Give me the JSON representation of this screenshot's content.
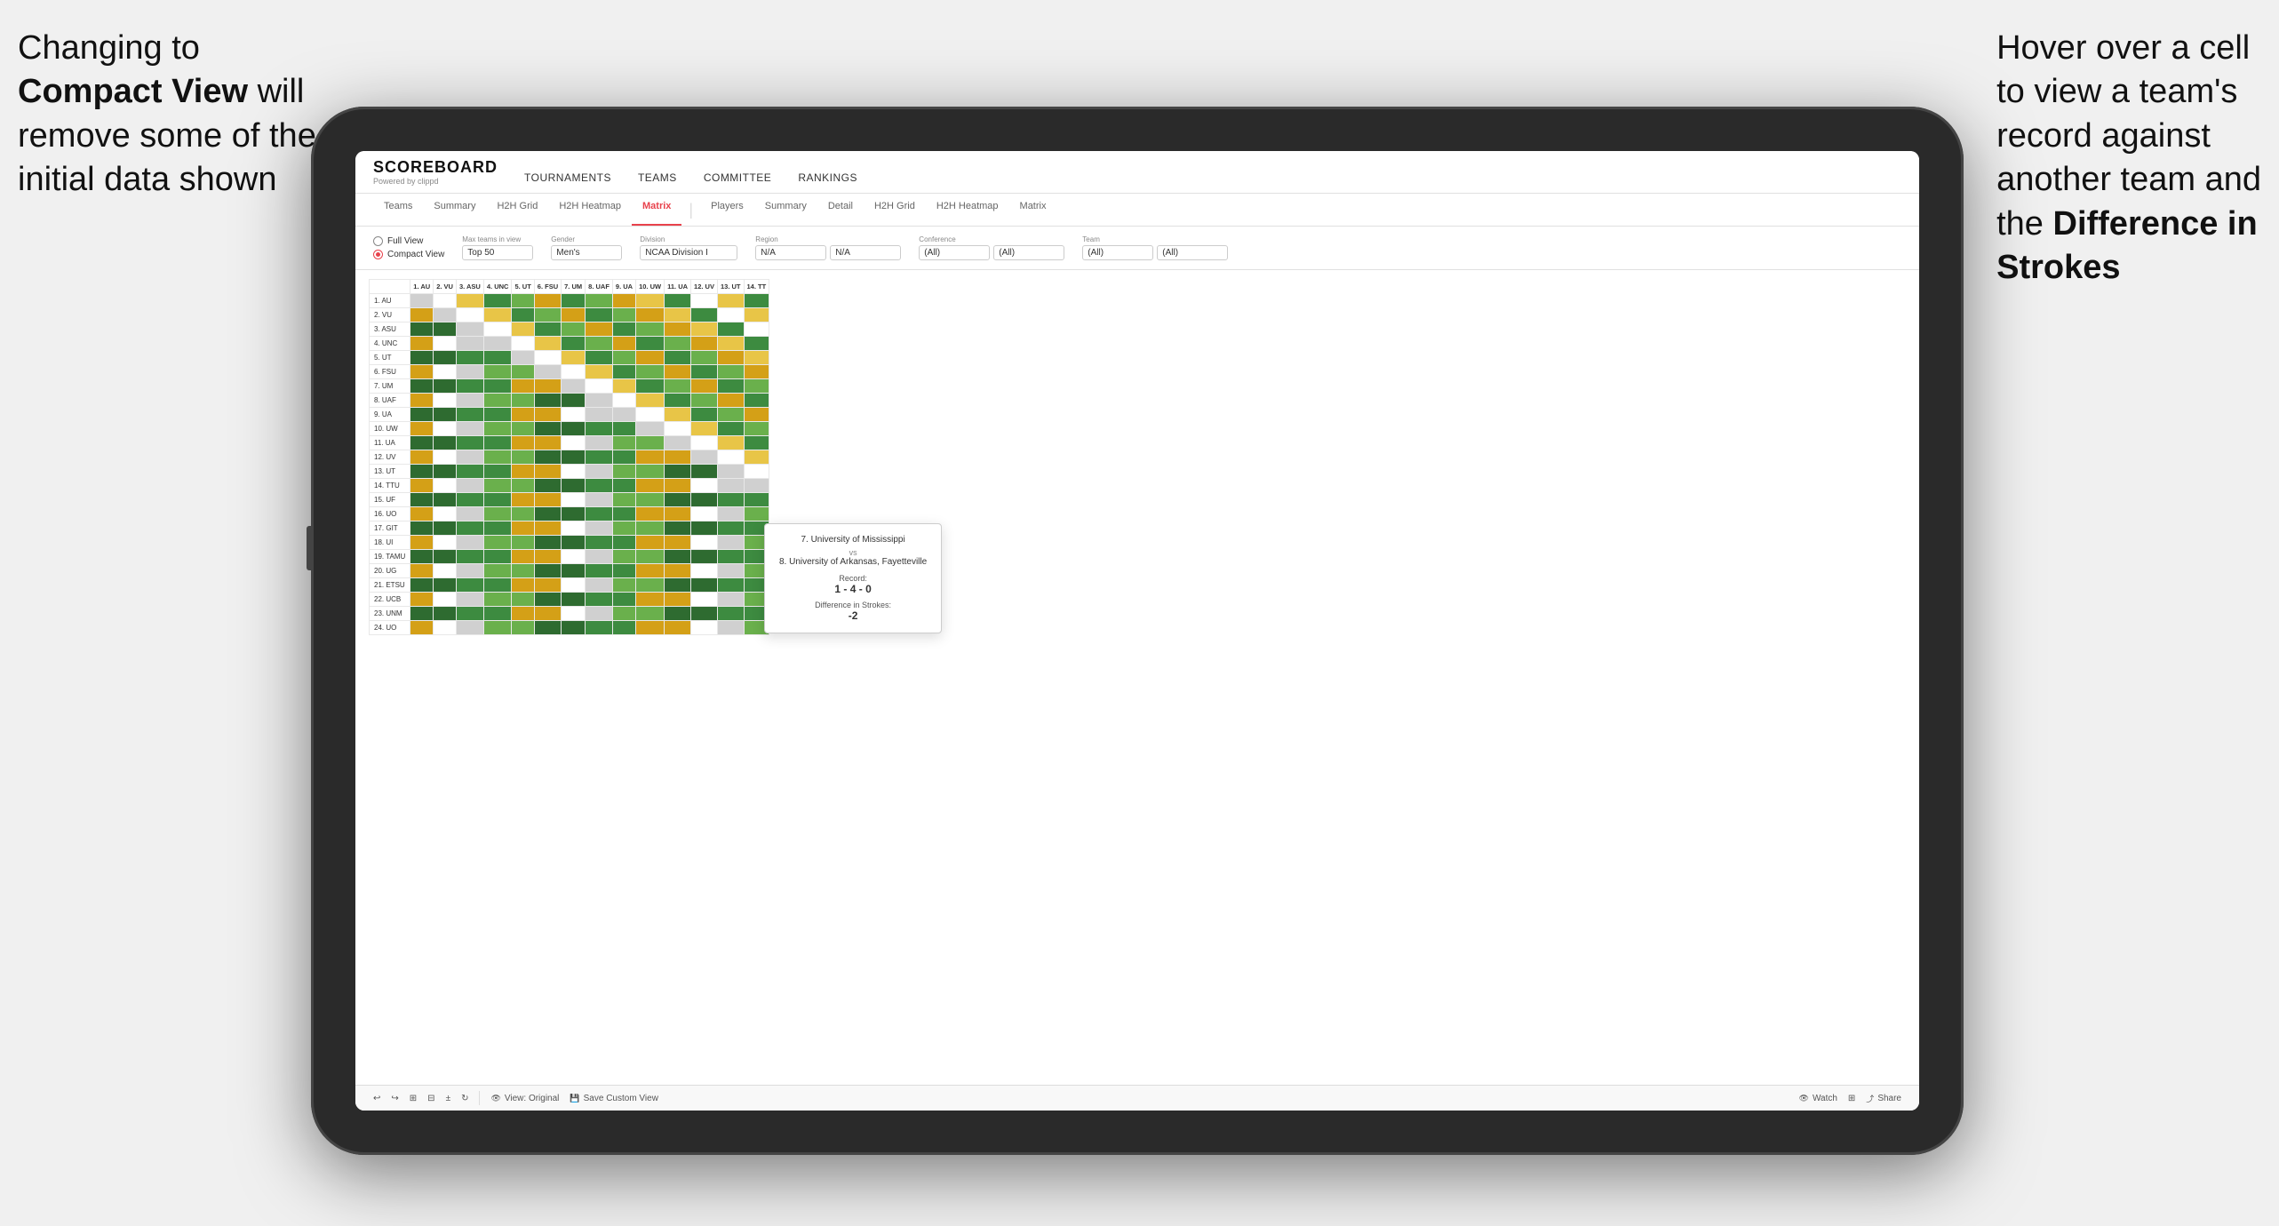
{
  "annotations": {
    "left": {
      "line1": "Changing to",
      "line2_bold": "Compact View",
      "line2_rest": " will",
      "line3": "remove some of the",
      "line4": "initial data shown"
    },
    "right": {
      "line1": "Hover over a cell",
      "line2": "to view a team's",
      "line3": "record against",
      "line4": "another team and",
      "line5_pre": "the ",
      "line5_bold": "Difference in",
      "line6_bold": "Strokes"
    }
  },
  "nav": {
    "logo": "SCOREBOARD",
    "logo_sub": "Powered by clippd",
    "links": [
      "TOURNAMENTS",
      "TEAMS",
      "COMMITTEE",
      "RANKINGS"
    ]
  },
  "sub_tabs": {
    "group1": [
      "Teams",
      "Summary",
      "H2H Grid",
      "H2H Heatmap",
      "Matrix"
    ],
    "group2": [
      "Players",
      "Summary",
      "Detail",
      "H2H Grid",
      "H2H Heatmap",
      "Matrix"
    ],
    "active": "Matrix"
  },
  "controls": {
    "view_options": {
      "label1": "Full View",
      "label2": "Compact View",
      "selected": "Compact View"
    },
    "filters": {
      "max_teams_label": "Max teams in view",
      "max_teams_value": "Top 50",
      "gender_label": "Gender",
      "gender_value": "Men's",
      "division_label": "Division",
      "division_value": "NCAA Division I",
      "region_label": "Region",
      "region_value1": "N/A",
      "region_value2": "N/A",
      "conference_label": "Conference",
      "conference_value1": "(All)",
      "conference_value2": "(All)",
      "team_label": "Team",
      "team_value1": "(All)",
      "team_value2": "(All)"
    }
  },
  "col_headers": [
    "1. AU",
    "2. VU",
    "3. ASU",
    "4. UNC",
    "5. UT",
    "6. FSU",
    "7. UM",
    "8. UAF",
    "9. UA",
    "10. UW",
    "11. UA",
    "12. UV",
    "13. UT",
    "14. TT"
  ],
  "row_headers": [
    "1. AU",
    "2. VU",
    "3. ASU",
    "4. UNC",
    "5. UT",
    "6. FSU",
    "7. UM",
    "8. UAF",
    "9. UA",
    "10. UW",
    "11. UA",
    "12. UV",
    "13. UT",
    "14. TTU",
    "15. UF",
    "16. UO",
    "17. GIT",
    "18. UI",
    "19. TAMU",
    "20. UG",
    "21. ETSU",
    "22. UCB",
    "23. UNM",
    "24. UO"
  ],
  "tooltip": {
    "team1": "7. University of Mississippi",
    "vs": "vs",
    "team2": "8. University of Arkansas, Fayetteville",
    "record_label": "Record:",
    "record_value": "1 - 4 - 0",
    "stroke_label": "Difference in Strokes:",
    "stroke_value": "-2"
  },
  "toolbar": {
    "view_original": "View: Original",
    "save_custom": "Save Custom View",
    "watch": "Watch",
    "share": "Share"
  }
}
